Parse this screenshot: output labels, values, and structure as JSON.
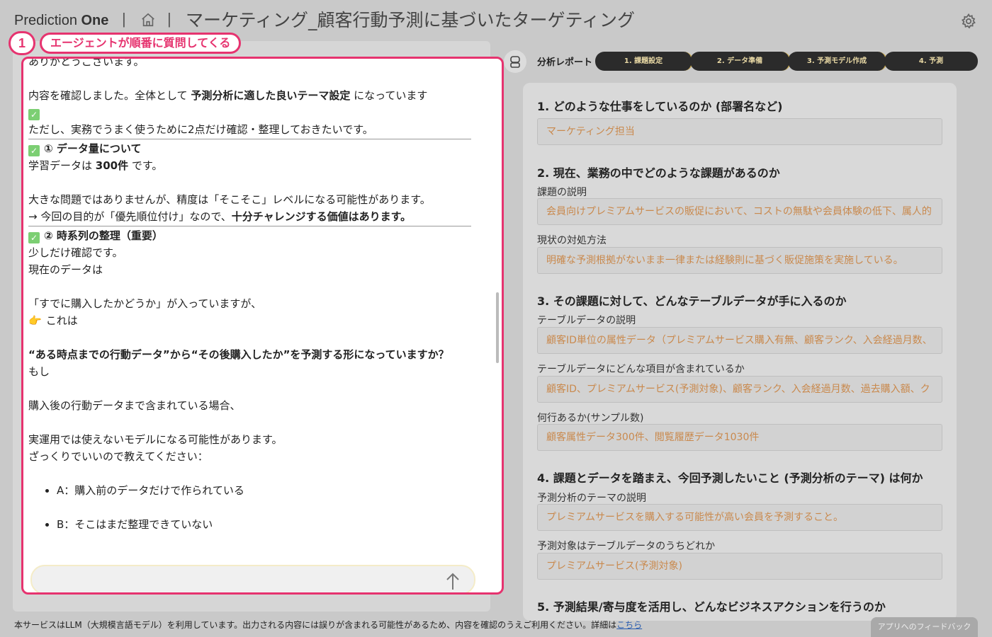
{
  "header": {
    "brand_prefix": "Prediction",
    "brand_suffix": "One",
    "separator": "|",
    "title": "マーケティング_顧客行動予測に基づいたターゲティング"
  },
  "annotation": {
    "number": "1",
    "label": "エージェントが順番に質問してくる"
  },
  "chat": {
    "line_thanks": "ありがとうございます。",
    "line_confirm_a": "内容を確認しました。全体として ",
    "line_confirm_b": "予測分析に適した良いテーマ設定",
    "line_confirm_c": " になっています",
    "line_however": "ただし、実務でうまく使うために2点だけ確認・整理しておきたいです。",
    "section1_title": "① データ量について",
    "data_a": "学習データは ",
    "data_b": "300件",
    "data_c": " です。",
    "accuracy": "大きな問題ではありませんが、精度は「そこそこ」レベルになる可能性があります。",
    "purpose_a": "→ 今回の目的が「優先順位付け」なので、",
    "purpose_b": "十分チャレンジする価値はあります。",
    "section2_title": "② 時系列の整理（重要）",
    "small_check": "少しだけ確認です。",
    "current_data": "現在のデータは",
    "already_bought": "「すでに購入したかどうか」が入っていますが、",
    "this_is": "これは",
    "emphasis": "“ある時点までの行動データ”から“その後購入したか”を予測する形になっていますか？",
    "if": "もし",
    "post_purchase": "購入後の行動データまで含まれている場合、",
    "unusable": "実運用では使えないモデルになる可能性があります。",
    "ask": "ざっくりでいいので教えてください：",
    "option_a": "A：購入前のデータだけで作られている",
    "option_b": "B：そこはまだ整理できていない",
    "input_placeholder": ""
  },
  "report": {
    "label": "分析レポート",
    "steps": [
      "1. 課題設定",
      "2. データ準備",
      "3. 予測モデル作成",
      "4. 予測"
    ],
    "s1_title": "1. どのような仕事をしているのか (部署名など)",
    "s1_value": "マーケティング担当",
    "s2_title": "2. 現在、業務の中でどのような課題があるのか",
    "s2_label1": "課題の説明",
    "s2_value1": "会員向けプレミアムサービスの販促において、コストの無駄や会員体験の低下、属人的",
    "s2_label2": "現状の対処方法",
    "s2_value2": "明確な予測根拠がないまま一律または経験則に基づく販促施策を実施している。",
    "s3_title": "3. その課題に対して、どんなテーブルデータが手に入るのか",
    "s3_label1": "テーブルデータの説明",
    "s3_value1": "顧客ID単位の属性データ（プレミアムサービス購入有無、顧客ランク、入会経過月数、",
    "s3_label2": "テーブルデータにどんな項目が含まれているか",
    "s3_value2": "顧客ID、プレミアムサービス(予測対象)、顧客ランク、入会経過月数、過去購入額、ク",
    "s3_label3": "何行あるか(サンプル数)",
    "s3_value3": "顧客属性データ300件、閲覧履歴データ1030件",
    "s4_title": "4. 課題とデータを踏まえ、今回予測したいこと (予測分析のテーマ) は何か",
    "s4_label1": "予測分析のテーマの説明",
    "s4_value1": "プレミアムサービスを購入する可能性が高い会員を予測すること。",
    "s4_label2": "予測対象はテーブルデータのうちどれか",
    "s4_value2": "プレミアムサービス(予測対象)",
    "s5_title": "5. 予測結果/寄与度を活用し、どんなビジネスアクションを行うのか"
  },
  "footer": {
    "note": "本サービスはLLM（大規模言語モデル）を利用しています。出力される内容には誤りが含まれる可能性があるため、内容を確認のうえご利用ください。詳細は",
    "link": "こちら",
    "feedback": "アプリへのフィードバック"
  },
  "colors": {
    "accent": "#e6336f",
    "field_text": "#c9894d",
    "step_bg": "#2b2b2b",
    "step_text": "#e8d8a4"
  }
}
